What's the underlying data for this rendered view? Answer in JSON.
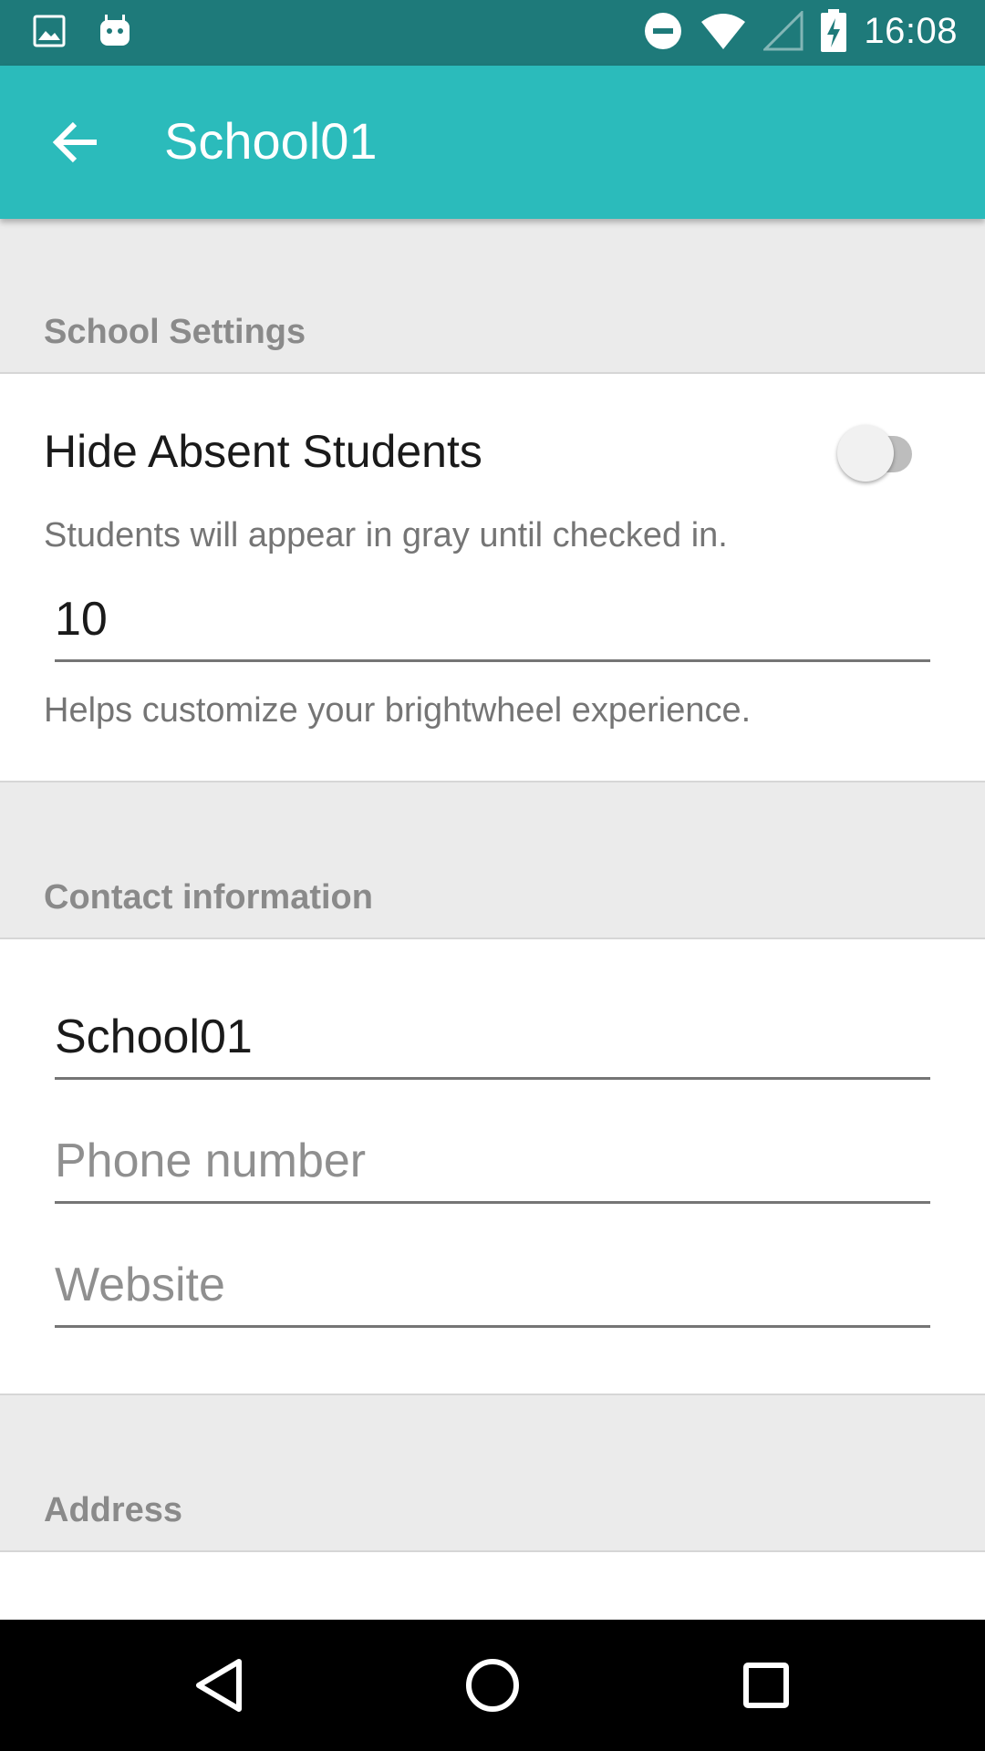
{
  "status_bar": {
    "time": "16:08",
    "left_icons": [
      "image-icon",
      "android-icon"
    ],
    "right_icons": [
      "do-not-disturb-icon",
      "wifi-icon",
      "cell-signal-icon",
      "battery-charging-icon"
    ]
  },
  "app_bar": {
    "title": "School01",
    "back_icon": "arrow-back-icon"
  },
  "school_settings": {
    "header": "School Settings",
    "hide_absent": {
      "title": "Hide Absent Students",
      "subtitle": "Students will appear in gray until checked in.",
      "enabled": false
    },
    "count_field": {
      "value": "10",
      "helper": "Helps customize your brightwheel experience."
    }
  },
  "contact": {
    "header": "Contact information",
    "name_field": {
      "value": "School01"
    },
    "phone_field": {
      "placeholder": "Phone number",
      "value": ""
    },
    "website_field": {
      "placeholder": "Website",
      "value": ""
    }
  },
  "address": {
    "header": "Address"
  },
  "nav_bar": {
    "buttons": [
      "back-triangle-icon",
      "home-circle-icon",
      "recents-square-icon"
    ]
  },
  "colors": {
    "status_bar": "#1e7a7a",
    "app_bar": "#2bbbbb",
    "section_bg": "#ebebeb",
    "section_label": "#8a8a8a"
  }
}
